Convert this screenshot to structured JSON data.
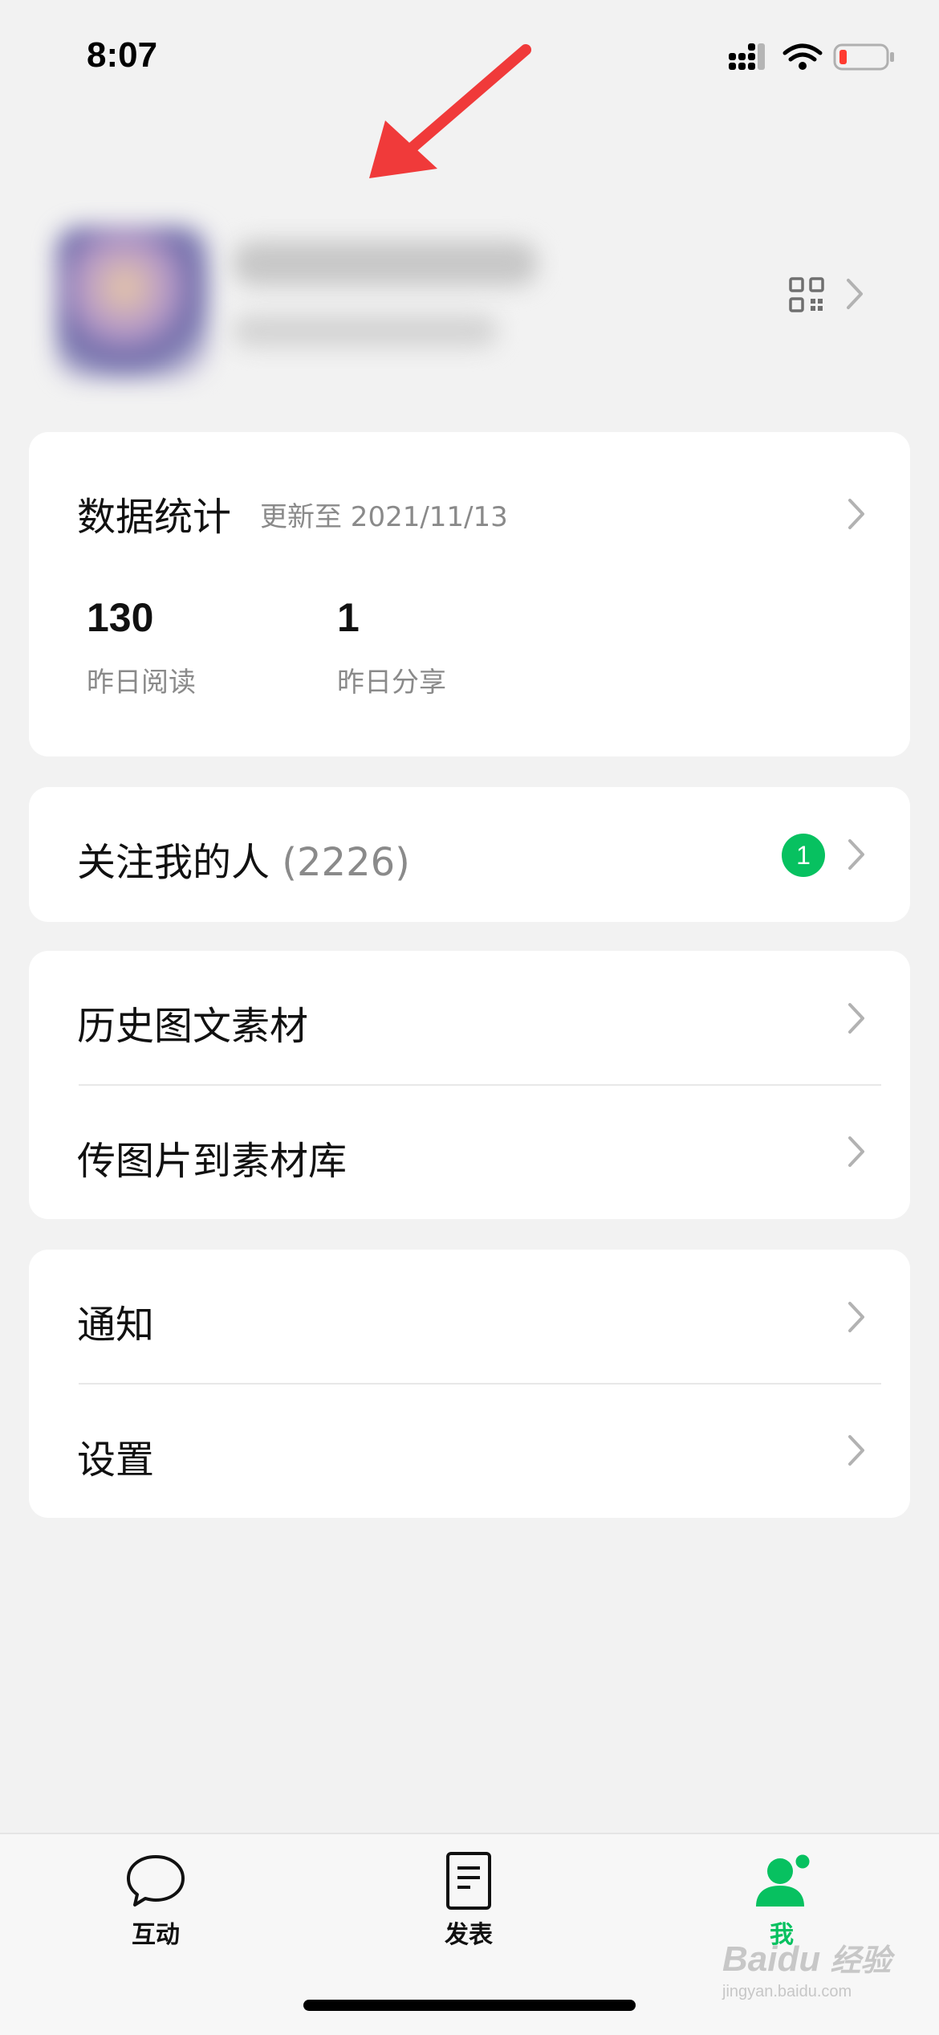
{
  "status_bar": {
    "time": "8:07"
  },
  "stats_card": {
    "title": "数据统计",
    "updated": "更新至 2021/11/13",
    "stats": [
      {
        "value": "130",
        "label": "昨日阅读"
      },
      {
        "value": "1",
        "label": "昨日分享"
      }
    ]
  },
  "followers": {
    "label": "关注我的人",
    "count": "(2226)",
    "badge": "1"
  },
  "materials": [
    {
      "label": "历史图文素材"
    },
    {
      "label": "传图片到素材库"
    }
  ],
  "settings_group": [
    {
      "label": "通知"
    },
    {
      "label": "设置"
    }
  ],
  "tabbar": {
    "tabs": [
      {
        "label": "互动",
        "icon": "chat-bubble-icon"
      },
      {
        "label": "发表",
        "icon": "document-icon"
      },
      {
        "label": "我",
        "icon": "person-icon",
        "active": true
      }
    ]
  },
  "watermark": {
    "brand": "Baidu",
    "cn": "经验",
    "url": "jingyan.baidu.com"
  },
  "colors": {
    "accent": "#07c160",
    "annotation_arrow": "#f03a3a",
    "background": "#f2f2f2"
  }
}
